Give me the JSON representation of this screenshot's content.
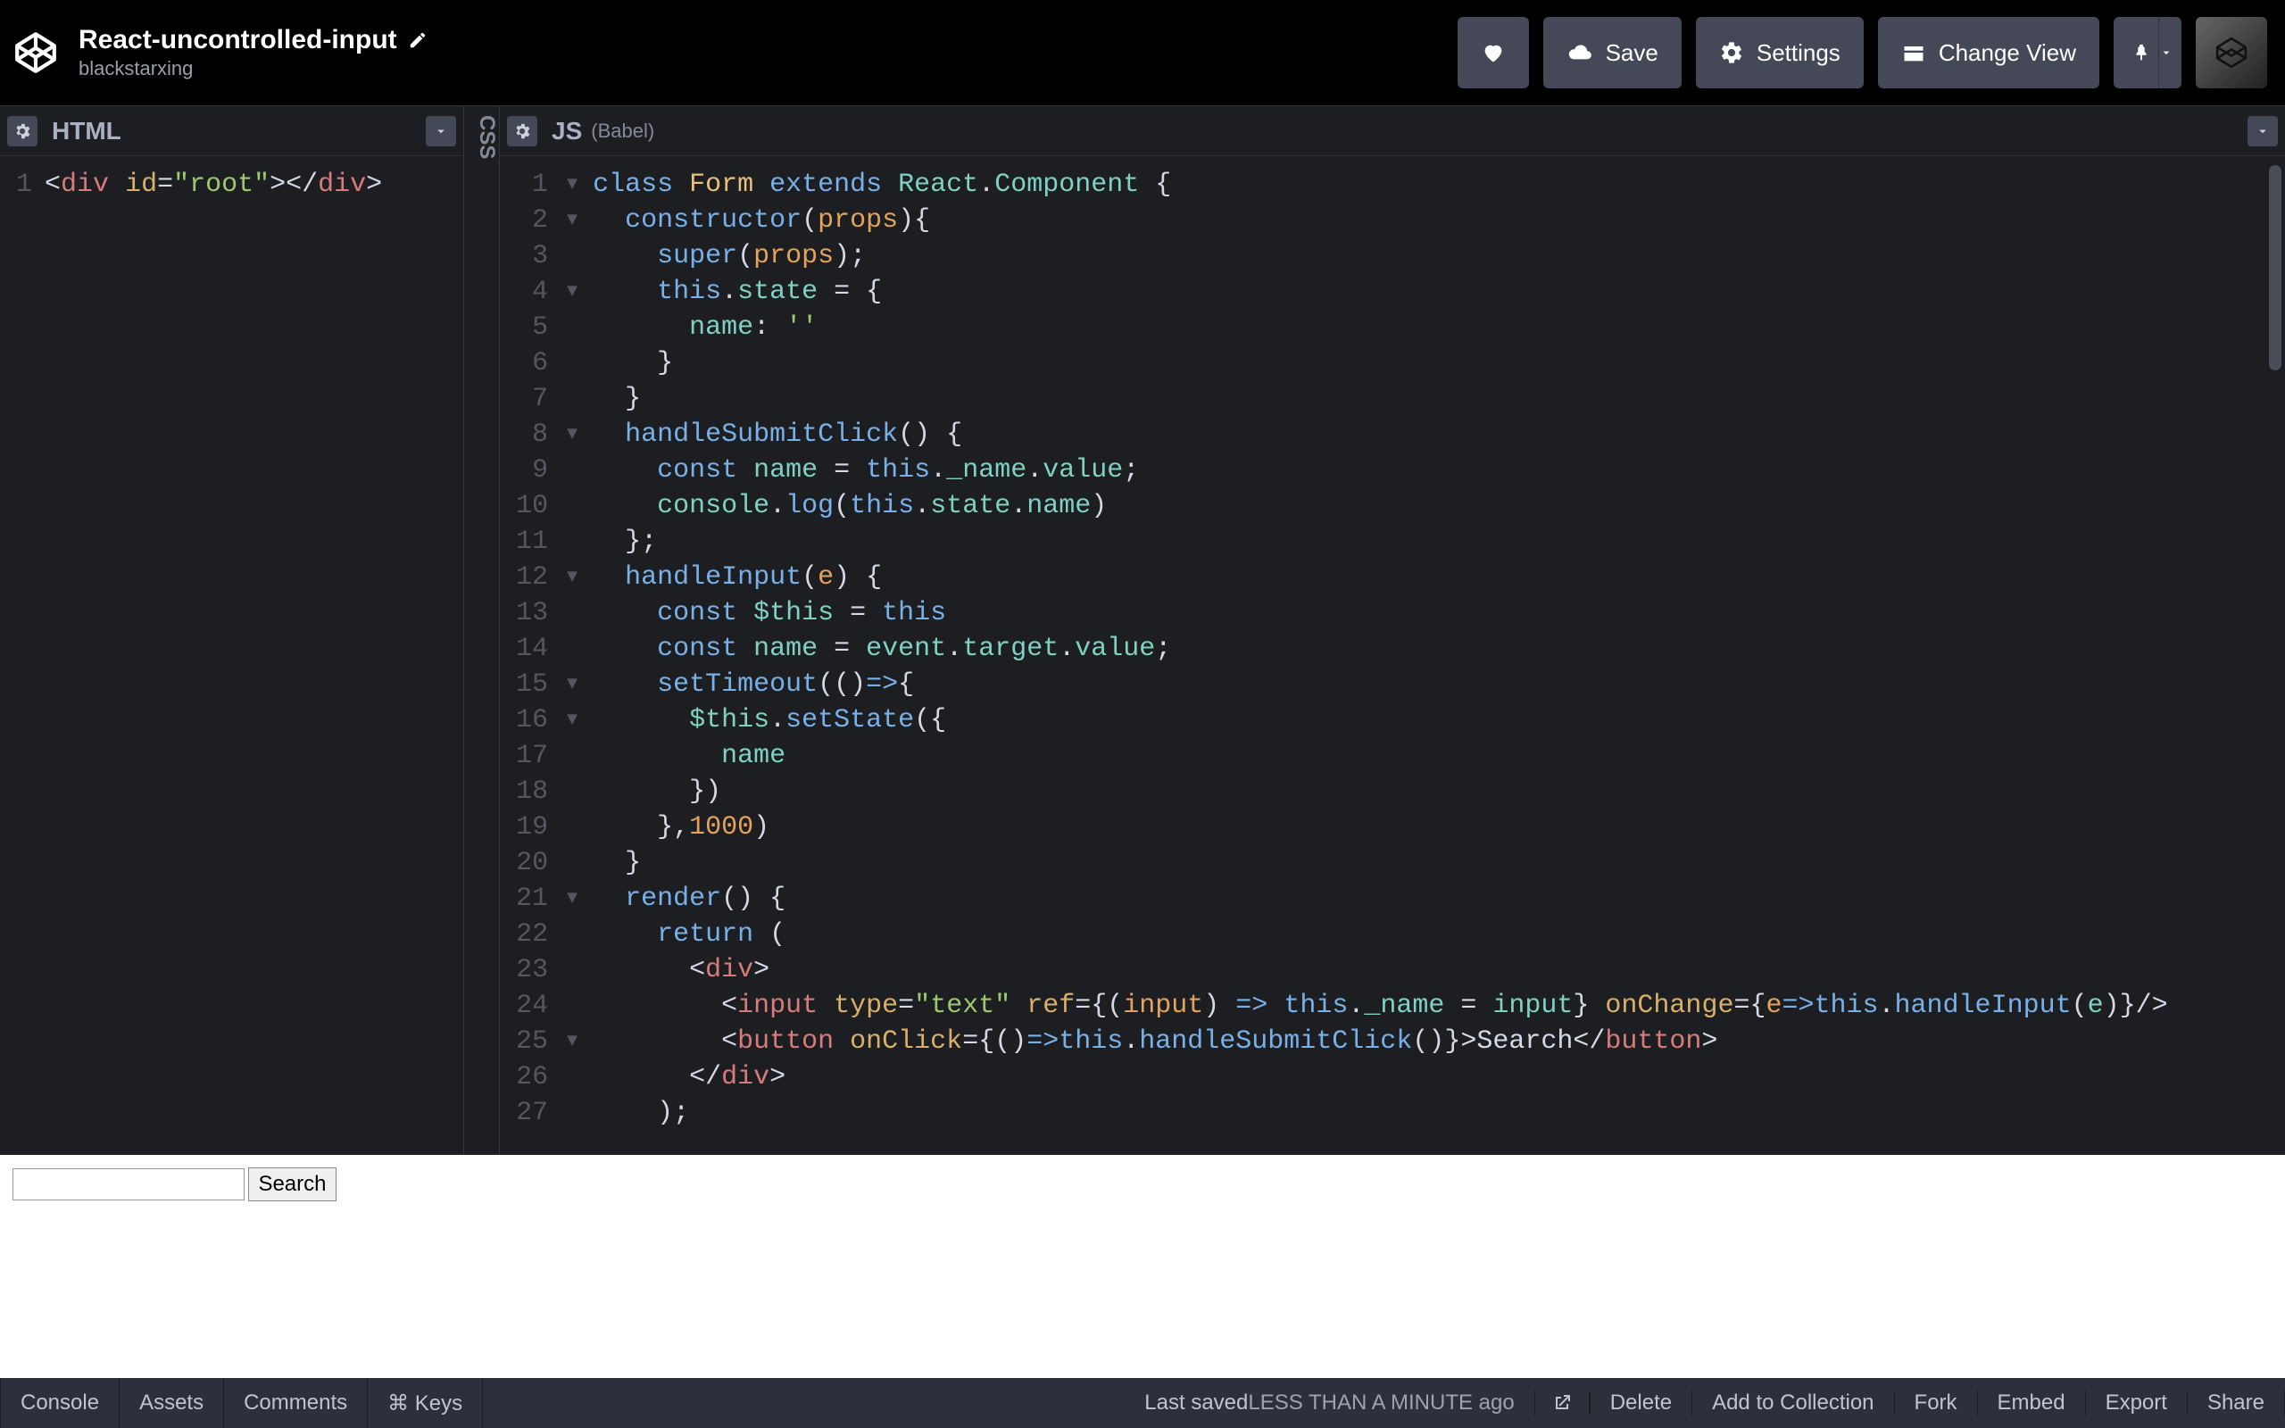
{
  "header": {
    "title": "React-uncontrolled-input",
    "author": "blackstarxing",
    "buttons": {
      "save": "Save",
      "settings": "Settings",
      "change_view": "Change View"
    }
  },
  "panels": {
    "html": {
      "label": "HTML"
    },
    "css": {
      "label": "CSS"
    },
    "js": {
      "label": "JS",
      "sublabel": "(Babel)"
    }
  },
  "html_code": {
    "line_numbers": [
      "1"
    ],
    "line1_raw": "<div id=\"root\"></div>"
  },
  "js_code": {
    "line_numbers": [
      "1",
      "2",
      "3",
      "4",
      "5",
      "6",
      "7",
      "8",
      "9",
      "10",
      "11",
      "12",
      "13",
      "14",
      "15",
      "16",
      "17",
      "18",
      "19",
      "20",
      "21",
      "22",
      "23",
      "24",
      "25",
      "26",
      "27"
    ],
    "fold_lines": [
      1,
      2,
      4,
      8,
      12,
      15,
      16,
      21,
      25
    ],
    "lines": {
      "l1": {
        "pre": "",
        "tokens": [
          [
            "class ",
            "t-blue"
          ],
          [
            "Form ",
            "t-yellow"
          ],
          [
            "extends ",
            "t-blue"
          ],
          [
            "React",
            "t-teal"
          ],
          [
            ".",
            "t-white"
          ],
          [
            "Component ",
            "t-teal"
          ],
          [
            "{",
            "t-white"
          ]
        ]
      },
      "l2": {
        "pre": "  ",
        "tokens": [
          [
            "constructor",
            "t-blue"
          ],
          [
            "(",
            "t-white"
          ],
          [
            "props",
            "t-orange"
          ],
          [
            "){",
            "t-white"
          ]
        ]
      },
      "l3": {
        "pre": "    ",
        "tokens": [
          [
            "super",
            "t-blue"
          ],
          [
            "(",
            "t-white"
          ],
          [
            "props",
            "t-orange"
          ],
          [
            ");",
            "t-white"
          ]
        ]
      },
      "l4": {
        "pre": "    ",
        "tokens": [
          [
            "this",
            "t-blue"
          ],
          [
            ".",
            "t-white"
          ],
          [
            "state ",
            "t-teal"
          ],
          [
            "= {",
            "t-white"
          ]
        ]
      },
      "l5": {
        "pre": "      ",
        "tokens": [
          [
            "name",
            "t-teal"
          ],
          [
            ": ",
            "t-white"
          ],
          [
            "''",
            "t-green"
          ]
        ]
      },
      "l6": {
        "pre": "    ",
        "tokens": [
          [
            "}",
            "t-white"
          ]
        ]
      },
      "l7": {
        "pre": "  ",
        "tokens": [
          [
            "}",
            "t-white"
          ]
        ]
      },
      "l8": {
        "pre": "  ",
        "tokens": [
          [
            "handleSubmitClick",
            "t-blue"
          ],
          [
            "() {",
            "t-white"
          ]
        ]
      },
      "l9": {
        "pre": "    ",
        "tokens": [
          [
            "const ",
            "t-blue"
          ],
          [
            "name ",
            "t-teal"
          ],
          [
            "= ",
            "t-white"
          ],
          [
            "this",
            "t-blue"
          ],
          [
            ".",
            "t-white"
          ],
          [
            "_name",
            "t-teal"
          ],
          [
            ".",
            "t-white"
          ],
          [
            "value",
            "t-teal"
          ],
          [
            ";",
            "t-white"
          ]
        ]
      },
      "l10": {
        "pre": "    ",
        "tokens": [
          [
            "console",
            "t-teal"
          ],
          [
            ".",
            "t-white"
          ],
          [
            "log",
            "t-blue"
          ],
          [
            "(",
            "t-white"
          ],
          [
            "this",
            "t-blue"
          ],
          [
            ".",
            "t-white"
          ],
          [
            "state",
            "t-teal"
          ],
          [
            ".",
            "t-white"
          ],
          [
            "name",
            "t-teal"
          ],
          [
            ")",
            "t-white"
          ]
        ]
      },
      "l11": {
        "pre": "  ",
        "tokens": [
          [
            "};",
            "t-white"
          ]
        ]
      },
      "l12": {
        "pre": "  ",
        "tokens": [
          [
            "handleInput",
            "t-blue"
          ],
          [
            "(",
            "t-white"
          ],
          [
            "e",
            "t-orange"
          ],
          [
            ") {",
            "t-white"
          ]
        ]
      },
      "l13": {
        "pre": "    ",
        "tokens": [
          [
            "const ",
            "t-blue"
          ],
          [
            "$this ",
            "t-teal"
          ],
          [
            "= ",
            "t-white"
          ],
          [
            "this",
            "t-blue"
          ]
        ]
      },
      "l14": {
        "pre": "    ",
        "tokens": [
          [
            "const ",
            "t-blue"
          ],
          [
            "name ",
            "t-teal"
          ],
          [
            "= ",
            "t-white"
          ],
          [
            "event",
            "t-teal"
          ],
          [
            ".",
            "t-white"
          ],
          [
            "target",
            "t-teal"
          ],
          [
            ".",
            "t-white"
          ],
          [
            "value",
            "t-teal"
          ],
          [
            ";",
            "t-white"
          ]
        ]
      },
      "l15": {
        "pre": "    ",
        "tokens": [
          [
            "setTimeout",
            "t-blue"
          ],
          [
            "(()",
            "t-white"
          ],
          [
            "=>",
            "t-blue"
          ],
          [
            "{",
            "t-white"
          ]
        ]
      },
      "l16": {
        "pre": "      ",
        "tokens": [
          [
            "$this",
            "t-teal"
          ],
          [
            ".",
            "t-white"
          ],
          [
            "setState",
            "t-blue"
          ],
          [
            "({",
            "t-white"
          ]
        ]
      },
      "l17": {
        "pre": "        ",
        "tokens": [
          [
            "name",
            "t-teal"
          ]
        ]
      },
      "l18": {
        "pre": "      ",
        "tokens": [
          [
            "})",
            "t-white"
          ]
        ]
      },
      "l19": {
        "pre": "    ",
        "tokens": [
          [
            "},",
            "t-white"
          ],
          [
            "1000",
            "t-orange"
          ],
          [
            ")",
            "t-white"
          ]
        ]
      },
      "l20": {
        "pre": "  ",
        "tokens": [
          [
            "}",
            "t-white"
          ]
        ]
      },
      "l21": {
        "pre": "  ",
        "tokens": [
          [
            "render",
            "t-blue"
          ],
          [
            "() {",
            "t-white"
          ]
        ]
      },
      "l22": {
        "pre": "    ",
        "tokens": [
          [
            "return ",
            "t-blue"
          ],
          [
            "(",
            "t-white"
          ]
        ]
      },
      "l23": {
        "pre": "      ",
        "tokens": [
          [
            "<",
            "t-white"
          ],
          [
            "div",
            "t-tag"
          ],
          [
            ">",
            "t-white"
          ]
        ]
      },
      "l24": {
        "pre": "        ",
        "tokens": [
          [
            "<",
            "t-white"
          ],
          [
            "input ",
            "t-tag"
          ],
          [
            "type",
            "t-attr"
          ],
          [
            "=",
            "t-white"
          ],
          [
            "\"text\" ",
            "t-str"
          ],
          [
            "ref",
            "t-attr"
          ],
          [
            "=",
            "t-white"
          ],
          [
            "{(",
            "t-white"
          ],
          [
            "input",
            "t-orange"
          ],
          [
            ") ",
            "t-white"
          ],
          [
            "=> ",
            "t-blue"
          ],
          [
            "this",
            "t-blue"
          ],
          [
            ".",
            "t-white"
          ],
          [
            "_name ",
            "t-teal"
          ],
          [
            "= ",
            "t-white"
          ],
          [
            "input",
            "t-teal"
          ],
          [
            "} ",
            "t-white"
          ],
          [
            "onChange",
            "t-attr"
          ],
          [
            "=",
            "t-white"
          ],
          [
            "{",
            "t-white"
          ],
          [
            "e",
            "t-orange"
          ],
          [
            "=>",
            "t-blue"
          ],
          [
            "this",
            "t-blue"
          ],
          [
            ".",
            "t-white"
          ],
          [
            "handleInput",
            "t-blue"
          ],
          [
            "(",
            "t-white"
          ],
          [
            "e",
            "t-teal"
          ],
          [
            ")}",
            "t-white"
          ],
          [
            "/>",
            "t-white"
          ]
        ]
      },
      "l25": {
        "pre": "        ",
        "tokens": [
          [
            "<",
            "t-white"
          ],
          [
            "button ",
            "t-tag"
          ],
          [
            "onClick",
            "t-attr"
          ],
          [
            "=",
            "t-white"
          ],
          [
            "{()",
            "t-white"
          ],
          [
            "=>",
            "t-blue"
          ],
          [
            "this",
            "t-blue"
          ],
          [
            ".",
            "t-white"
          ],
          [
            "handleSubmitClick",
            "t-blue"
          ],
          [
            "()}>",
            "t-white"
          ],
          [
            "Search",
            "t-white"
          ],
          [
            "</",
            "t-white"
          ],
          [
            "button",
            "t-tag"
          ],
          [
            ">",
            "t-white"
          ]
        ]
      },
      "l26": {
        "pre": "      ",
        "tokens": [
          [
            "</",
            "t-white"
          ],
          [
            "div",
            "t-tag"
          ],
          [
            ">",
            "t-white"
          ]
        ]
      },
      "l27": {
        "pre": "    ",
        "tokens": [
          [
            ");",
            "t-white"
          ]
        ]
      }
    }
  },
  "output": {
    "search_button": "Search"
  },
  "footer": {
    "left": [
      "Console",
      "Assets",
      "Comments",
      "⌘ Keys"
    ],
    "saved_prefix": "Last saved ",
    "saved_time": "LESS THAN A MINUTE ago",
    "right": [
      "Delete",
      "Add to Collection",
      "Fork",
      "Embed",
      "Export",
      "Share"
    ]
  }
}
